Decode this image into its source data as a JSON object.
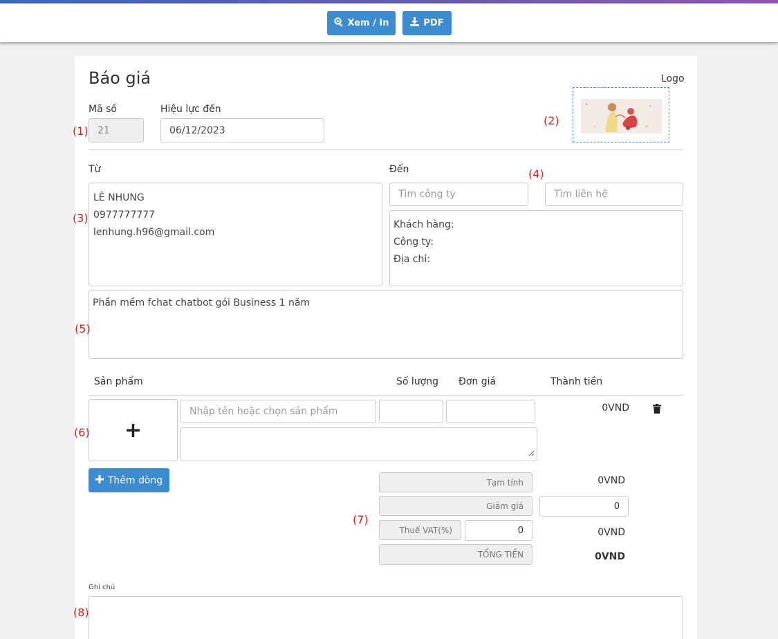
{
  "toolbar": {
    "view_print_label": "Xem / In",
    "pdf_label": "PDF"
  },
  "header": {
    "title": "Báo giá",
    "logo_label": "Logo"
  },
  "fields": {
    "code_label": "Mã số",
    "code_value": "21",
    "valid_label": "Hiệu lực đến",
    "valid_value": "06/12/2023"
  },
  "from": {
    "label": "Từ",
    "lines": [
      "LÊ NHUNG",
      "0977777777",
      "lenhung.h96@gmail.com"
    ]
  },
  "to": {
    "label": "Đến",
    "company_placeholder": "Tìm công ty",
    "contact_placeholder": "Tìm liên hệ",
    "info": [
      "Khách hàng:",
      "Công ty:",
      "Địa chỉ:"
    ]
  },
  "description": "Phần mềm fchat chatbot gói Business 1 năm",
  "products": {
    "headers": {
      "product": "Sản phẩm",
      "qty": "Số lượng",
      "price": "Đơn giá",
      "total": "Thành tiền"
    },
    "name_placeholder": "Nhập tên hoặc chọn sản phẩm",
    "add_image_symbol": "+",
    "row_total": "0VND",
    "add_row_label": "Thêm dòng"
  },
  "summary": {
    "subtotal_label": "Tạm tính",
    "subtotal_value": "0VND",
    "discount_label": "Giảm giá",
    "discount_value": "0",
    "vat_label": "Thuế VAT(%)",
    "vat_rate": "0",
    "vat_value": "0VND",
    "grand_total_label": "TỔNG TIỀN",
    "grand_total_value": "0VND"
  },
  "notes": {
    "label": "Ghi chú"
  },
  "annotations": [
    "(1)",
    "(2)",
    "(3)",
    "(4)",
    "(5)",
    "(6)",
    "(7)",
    "(8)"
  ],
  "colors": {
    "accent": "#3d8bd0",
    "annotation": "#d62020",
    "delete_icon": "#222222"
  },
  "icons": [
    "zoom-icon",
    "download-icon",
    "trash-icon",
    "plus-icon",
    "resize-handle-icon"
  ]
}
